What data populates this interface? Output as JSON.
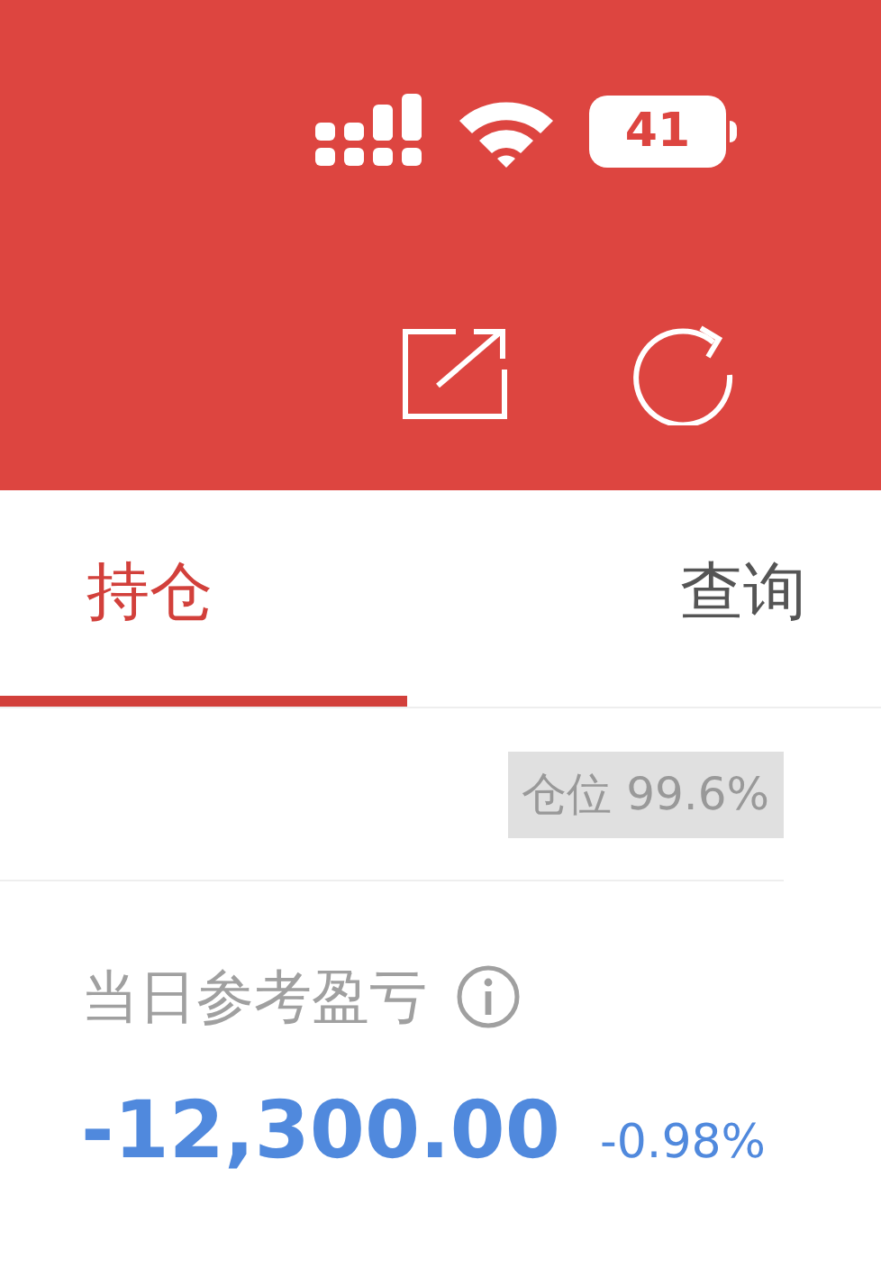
{
  "status_bar": {
    "battery": "41"
  },
  "tabs": [
    {
      "label": "持仓",
      "selected": true
    },
    {
      "label": "查询",
      "selected": false
    }
  ],
  "position_badge": "仓位 99.6%",
  "pnl": {
    "label": "当日参考盈亏",
    "value": "-12,300.00",
    "percent": "-0.98%"
  }
}
